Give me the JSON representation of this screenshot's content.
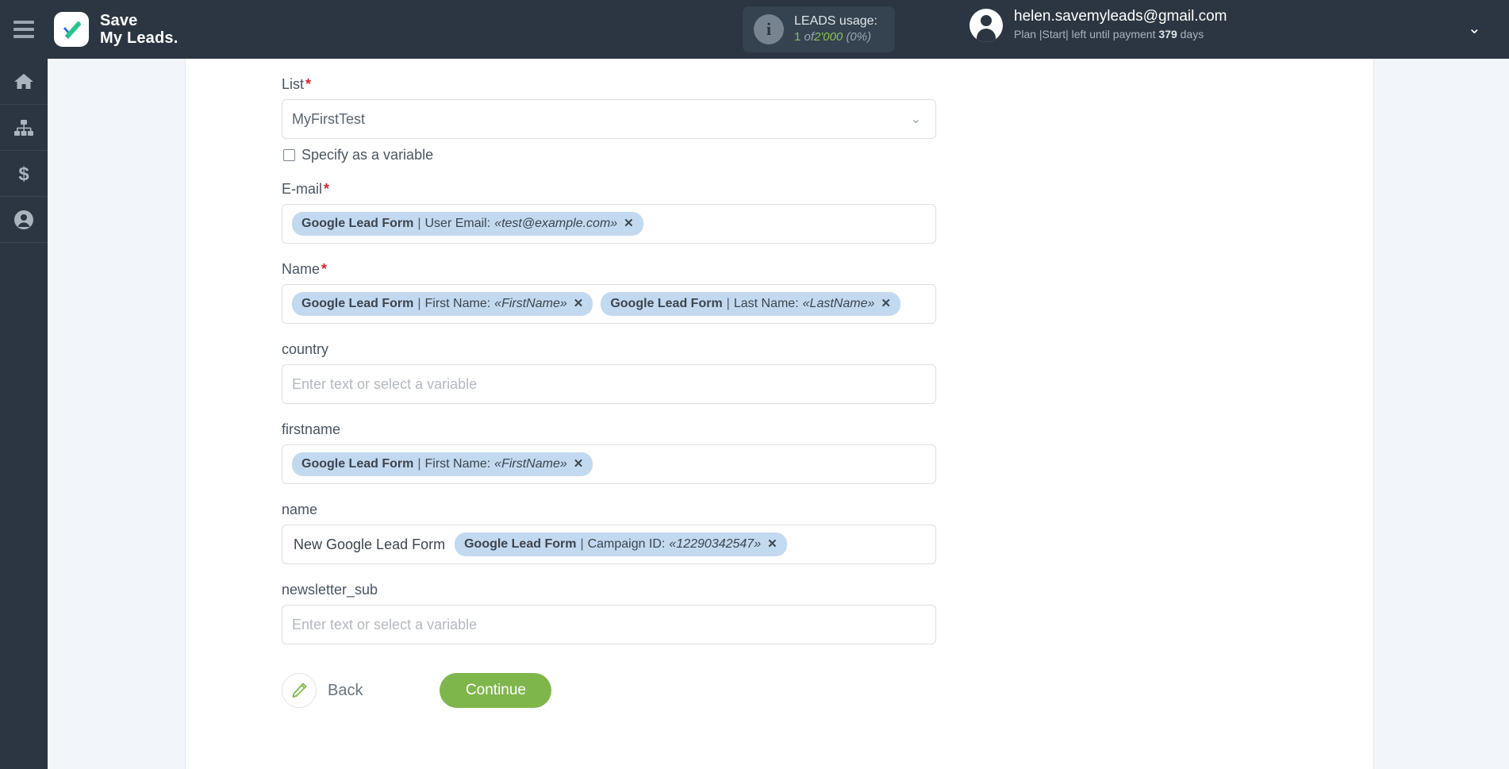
{
  "header": {
    "brand": {
      "line1": "Save",
      "line2": "My Leads."
    },
    "usage": {
      "title": "LEADS usage:",
      "used": "1",
      "of": "of",
      "total": "2'000",
      "percent": "(0%)"
    },
    "account": {
      "email": "helen.savemyleads@gmail.com",
      "plan_prefix": "Plan |Start| left until payment",
      "days_value": "379",
      "days_suffix": "days"
    }
  },
  "sidebar": {
    "items": [
      {
        "name": "home",
        "icon": "home-icon"
      },
      {
        "name": "connections",
        "icon": "sitemap-icon"
      },
      {
        "name": "billing",
        "icon": "dollar-icon"
      },
      {
        "name": "account",
        "icon": "user-icon"
      }
    ]
  },
  "form": {
    "placeholder": "Enter text or select a variable",
    "list": {
      "label": "List",
      "required": "*",
      "value": "MyFirstTest",
      "checkbox_label": "Specify as a variable",
      "checked": false
    },
    "fields": [
      {
        "label": "E-mail",
        "required": "*",
        "plain": "",
        "tags": [
          {
            "src": "Google Lead Form",
            "sep": "|",
            "fld": "User Email:",
            "val": "«test@example.com»",
            "x": "✕"
          }
        ]
      },
      {
        "label": "Name",
        "required": "*",
        "plain": "",
        "tags": [
          {
            "src": "Google Lead Form",
            "sep": "|",
            "fld": "First Name:",
            "val": "«FirstName»",
            "x": "✕"
          },
          {
            "src": "Google Lead Form",
            "sep": "|",
            "fld": "Last Name:",
            "val": "«LastName»",
            "x": "✕"
          }
        ]
      },
      {
        "label": "country",
        "required": "",
        "plain": "",
        "tags": []
      },
      {
        "label": "firstname",
        "required": "",
        "plain": "",
        "tags": [
          {
            "src": "Google Lead Form",
            "sep": "|",
            "fld": "First Name:",
            "val": "«FirstName»",
            "x": "✕"
          }
        ]
      },
      {
        "label": "name",
        "required": "",
        "plain": "New Google Lead Form",
        "tags": [
          {
            "src": "Google Lead Form",
            "sep": "|",
            "fld": "Campaign ID:",
            "val": "«12290342547»",
            "x": "✕"
          }
        ]
      },
      {
        "label": "newsletter_sub",
        "required": "",
        "plain": "",
        "tags": []
      }
    ],
    "back_label": "Back",
    "continue_label": "Continue"
  },
  "colors": {
    "header_bg": "#2b3642",
    "accent_green": "#7fb64c",
    "tag_bg": "#c3d9f0",
    "required_red": "#d9232d",
    "page_bg": "#f2f5fa"
  }
}
